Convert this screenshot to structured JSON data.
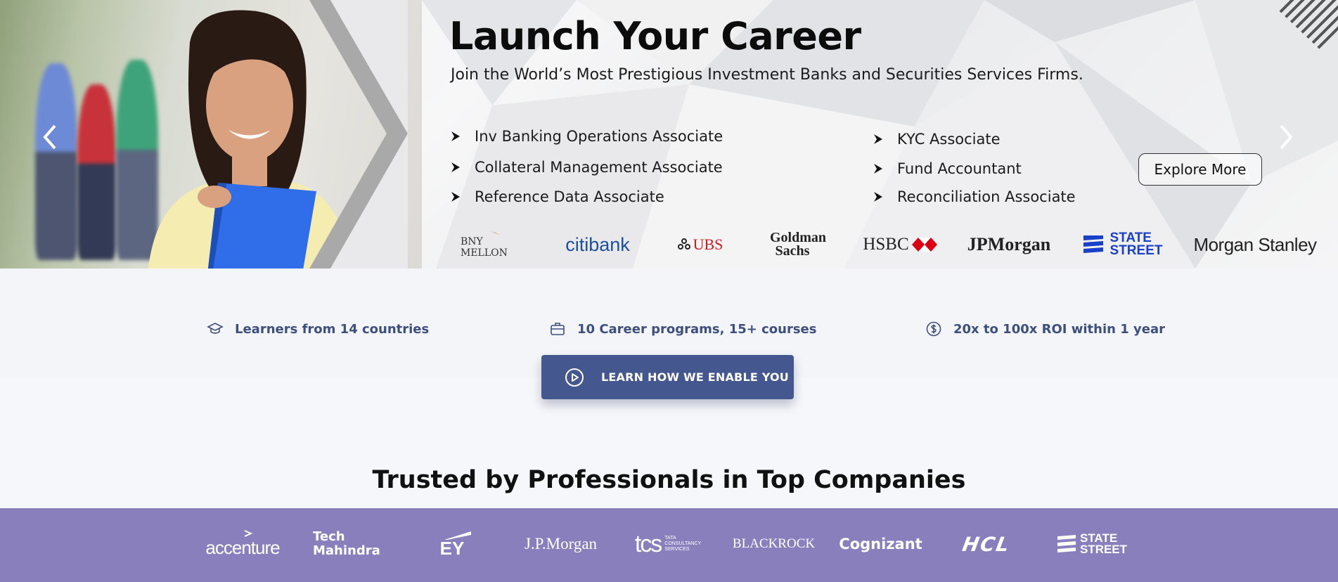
{
  "hero": {
    "title": "Launch Your Career",
    "subtitle": "Join the World’s Most Prestigious Investment Banks and Securities Services Firms.",
    "roles_left": [
      "Inv Banking Operations Associate",
      "Collateral Management Associate",
      "Reference Data Associate"
    ],
    "roles_right": [
      "KYC Associate",
      "Fund Accountant",
      "Reconciliation Associate"
    ],
    "explore_label": "Explore More",
    "bank_logos": {
      "bny": "BNY MELLON",
      "citi": "citibank",
      "ubs": "UBS",
      "goldman_1": "Goldman",
      "goldman_2": "Sachs",
      "hsbc": "HSBC",
      "jpmorgan": "JPMorgan",
      "statestreet_1": "STATE",
      "statestreet_2": "STREET",
      "morganstanley": "Morgan Stanley"
    }
  },
  "stats": {
    "learners": "Learners from 14 countries",
    "programs": "10 Career programs, 15+ courses",
    "roi": "20x to 100x ROI within 1 year"
  },
  "cta": {
    "label": "LEARN HOW WE ENABLE YOU"
  },
  "trusted": {
    "title": "Trusted by Professionals in Top Companies"
  },
  "companies": {
    "accenture": "accenture",
    "tech_1": "Tech",
    "tech_2": "Mahindra",
    "ey": "EY",
    "jpm": "J.P.Morgan",
    "tcs": "tcs",
    "tcs_small_1": "TATA",
    "tcs_small_2": "CONSULTANCY",
    "tcs_small_3": "SERVICES",
    "blackrock": "BLACKROCK",
    "cognizant": "Cognizant",
    "hcl": "HCL",
    "ss_1": "STATE",
    "ss_2": "STREET"
  },
  "colors": {
    "accent": "#44578f",
    "stat_text": "#3d4f7c",
    "company_band": "#8a7fbd",
    "statestreet_blue": "#1a3fc8"
  }
}
